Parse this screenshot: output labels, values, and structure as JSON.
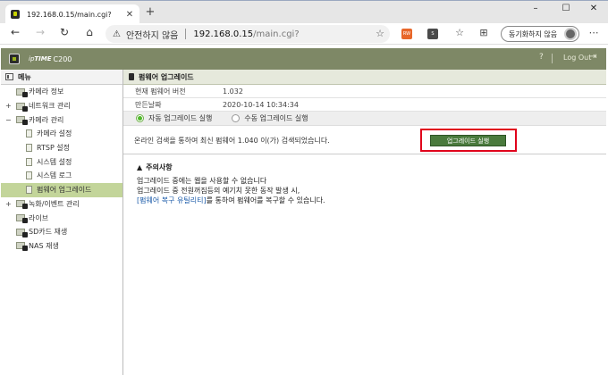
{
  "browser": {
    "tab_title": "192.168.0.15/main.cgi?",
    "tab_close": "✕",
    "new_tab": "+",
    "window_controls": [
      "–",
      "☐",
      "✕"
    ],
    "back": "←",
    "forward": "→",
    "reload": "↻",
    "home": "⌂",
    "warning_icon": "⚠",
    "insecure_label": "안전하지 않음",
    "url_host": "192.168.0.15",
    "url_path": "/main.cgi?",
    "star": "☆",
    "extensions": [
      {
        "label": "RW",
        "color": "#e8672a"
      },
      {
        "label": "S",
        "color": "#4a4a4a"
      }
    ],
    "favorites_icon": "☆",
    "collections_icon": "⊞",
    "sync_label": "동기화하지 않음",
    "more": "⋯"
  },
  "app": {
    "brand_prefix": "ip",
    "brand": "TIME",
    "model": "C200",
    "help": "?",
    "logout": "Log Out",
    "logout_icon": "⇥"
  },
  "sidebar": {
    "title": "메뉴",
    "items": [
      {
        "label": "카메라 정보",
        "level": 0,
        "toggle": "",
        "active": false
      },
      {
        "label": "네트워크 관리",
        "level": 0,
        "toggle": "+",
        "active": false
      },
      {
        "label": "카메라 관리",
        "level": 0,
        "toggle": "−",
        "active": false
      },
      {
        "label": "카메라 설정",
        "level": 1,
        "toggle": "",
        "active": false
      },
      {
        "label": "RTSP 설정",
        "level": 1,
        "toggle": "",
        "active": false
      },
      {
        "label": "시스템 설정",
        "level": 1,
        "toggle": "",
        "active": false
      },
      {
        "label": "시스템 로그",
        "level": 1,
        "toggle": "",
        "active": false
      },
      {
        "label": "펌웨어 업그레이드",
        "level": 1,
        "toggle": "",
        "active": true
      },
      {
        "label": "녹화/이벤트 관리",
        "level": 0,
        "toggle": "+",
        "active": false
      },
      {
        "label": "라이브",
        "level": 0,
        "toggle": "",
        "active": false
      },
      {
        "label": "SD카드 재생",
        "level": 0,
        "toggle": "",
        "active": false
      },
      {
        "label": "NAS 재생",
        "level": 0,
        "toggle": "",
        "active": false
      }
    ]
  },
  "main": {
    "section_title": "펌웨어 업그레이드",
    "current_version_label": "현재 펌웨어 버전",
    "current_version": "1.032",
    "build_date_label": "만든날짜",
    "build_date": "2020-10-14 10:34:34",
    "auto_upgrade_label": "자동 업그레이드 실행",
    "manual_upgrade_label": "수동 업그레이드 실행",
    "selected_mode": "auto",
    "online_message": "온라인 검색을 통하여 최신 펌웨어 1.040 이(가) 검색되었습니다.",
    "upgrade_button": "업그레이드 실행",
    "notice_title": "주의사항",
    "notice_lines": [
      "업그레이드 중에는 웹을 사용할 수 없습니다",
      "업그레이드 중 전원꺼짐등의 예기치 못한 동작 발생 시,"
    ],
    "notice_link": "[펌웨어 복구 유틸리티]",
    "notice_link_suffix": "를 통하여 펌웨어를 복구할 수 있습니다."
  },
  "colors": {
    "header": "#7e8866",
    "active_menu": "#c3d59a",
    "button": "#4a7a3d",
    "highlight": "#e0001b",
    "link": "#1a5aa8"
  }
}
